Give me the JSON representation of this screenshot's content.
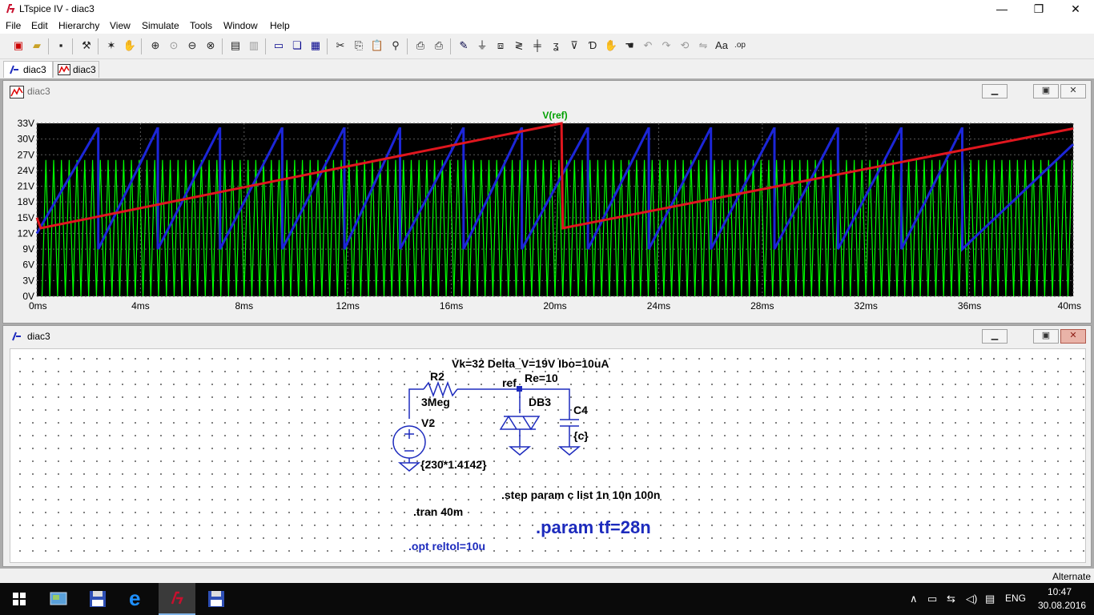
{
  "window": {
    "title": "LTspice IV - diac3",
    "controls": {
      "minimize": "—",
      "restore": "❐",
      "close": "✕"
    }
  },
  "menu": [
    "File",
    "Edit",
    "Hierarchy",
    "View",
    "Simulate",
    "Tools",
    "Window",
    "Help"
  ],
  "doc_tabs": [
    {
      "label": "diac3",
      "icon": "schematic-icon",
      "active": true
    },
    {
      "label": "diac3",
      "icon": "waveform-icon",
      "active": false
    }
  ],
  "plot_window": {
    "title": "diac3",
    "trace_label": "V(ref)"
  },
  "schematic_window": {
    "title": "diac3"
  },
  "chart_data": {
    "type": "line",
    "title": "",
    "xlabel": "",
    "ylabel": "",
    "trace_name": "V(ref)",
    "xlim": [
      0,
      40
    ],
    "ylim": [
      0,
      33
    ],
    "x_unit": "ms",
    "y_unit": "V",
    "x_ticks": [
      "0ms",
      "4ms",
      "8ms",
      "12ms",
      "16ms",
      "20ms",
      "24ms",
      "28ms",
      "32ms",
      "36ms",
      "40ms"
    ],
    "y_ticks": [
      "0V",
      "3V",
      "6V",
      "9V",
      "12V",
      "15V",
      "18V",
      "21V",
      "24V",
      "27V",
      "30V",
      "33V"
    ],
    "grid": true,
    "background": "#000000",
    "series": [
      {
        "name": "",
        "color": "#00ff00",
        "kind": "oscillation",
        "period_ms": 0.3,
        "low": 0,
        "high": 26,
        "x_start": 0.2,
        "x_end": 40
      },
      {
        "name": "",
        "color": "#1c26d8",
        "kind": "sawtooth",
        "low": 9,
        "high": 32,
        "peaks_ms": [
          2.35,
          4.65,
          7.05,
          9.45,
          11.85,
          14.0,
          16.45,
          18.7,
          21.25,
          23.6,
          26.0,
          28.45,
          30.9,
          33.35,
          35.7
        ]
      },
      {
        "name": "",
        "color": "#e0161e",
        "kind": "points",
        "points": [
          [
            0,
            15
          ],
          [
            0.15,
            13
          ],
          [
            20.25,
            33
          ],
          [
            20.3,
            13
          ],
          [
            40,
            32
          ]
        ]
      }
    ]
  },
  "schematic": {
    "labels": {
      "diac_params": "Vk=32 Delta_V=19V Ibo=10uA",
      "r2_name": "R2",
      "r2_value": "3Meg",
      "node_ref": "ref",
      "re": "Re=10",
      "db3": "DB3",
      "c4_name": "C4",
      "c4_value": "{c}",
      "v2_name": "V2",
      "v2_value": "{230*1.4142}",
      "step": ".step param c list 1n 10n 100n",
      "tran": ".tran 40m",
      "param": ".param tf=28n",
      "opt": ".opt reltol=10u"
    }
  },
  "status": {
    "mode": "Alternate"
  },
  "taskbar": {
    "lang": "ENG",
    "time": "10:47",
    "date": "30.08.2016"
  }
}
